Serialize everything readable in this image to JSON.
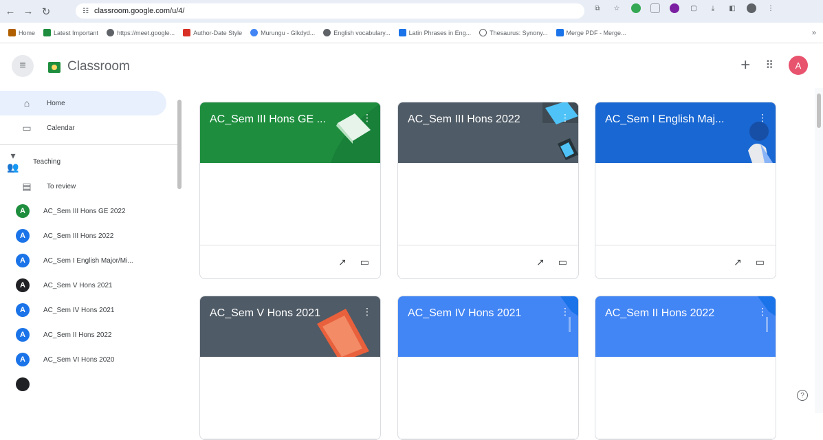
{
  "browser": {
    "url": "classroom.google.com/u/4/",
    "bookmarks": [
      {
        "label": "Home",
        "color": "#b06000"
      },
      {
        "label": "Latest Important",
        "color": "#1e8e3e"
      },
      {
        "label": "https://meet.google...",
        "color": "#5f6368"
      },
      {
        "label": "Author-Date Style",
        "color": "#d93025"
      },
      {
        "label": "Murungu - Glkdyd...",
        "color": "#4285f4"
      },
      {
        "label": "English vocabulary...",
        "color": "#5f6368"
      },
      {
        "label": "Latin Phrases in Eng...",
        "color": "#1a73e8"
      },
      {
        "label": "Thesaurus: Synony...",
        "color": "#5f6368"
      },
      {
        "label": "Merge PDF - Merge...",
        "color": "#1a73e8"
      }
    ],
    "more": "»"
  },
  "app": {
    "title": "Classroom",
    "avatar_letter": "A",
    "plus": "+",
    "apps_icon": "apps-icon"
  },
  "sidebar": {
    "home": "Home",
    "calendar": "Calendar",
    "teaching": "Teaching",
    "to_review": "To review",
    "classes": [
      {
        "letter": "A",
        "name": "AC_Sem III Hons GE 2022",
        "color": "#1e8e3e"
      },
      {
        "letter": "A",
        "name": "AC_Sem III Hons 2022",
        "color": "#1a73e8"
      },
      {
        "letter": "A",
        "name": "AC_Sem I English Major/Mi...",
        "color": "#1a73e8"
      },
      {
        "letter": "A",
        "name": "AC_Sem V Hons 2021",
        "color": "#202124"
      },
      {
        "letter": "A",
        "name": "AC_Sem IV Hons 2021",
        "color": "#1a73e8"
      },
      {
        "letter": "A",
        "name": "AC_Sem II Hons 2022",
        "color": "#1a73e8"
      },
      {
        "letter": "A",
        "name": "AC_Sem VI Hons 2020",
        "color": "#1a73e8"
      }
    ]
  },
  "cards": [
    {
      "title": "AC_Sem III Hons GE ...",
      "color": "#1e8e3e"
    },
    {
      "title": "AC_Sem III Hons 2022",
      "color": "#4f5b66"
    },
    {
      "title": "AC_Sem I English Maj...",
      "color": "#1967d2"
    },
    {
      "title": "AC_Sem V Hons 2021",
      "color": "#4f5b66"
    },
    {
      "title": "AC_Sem IV Hons 2021",
      "color": "#4285f4"
    },
    {
      "title": "AC_Sem II Hons 2022",
      "color": "#4285f4"
    }
  ],
  "help": "?"
}
